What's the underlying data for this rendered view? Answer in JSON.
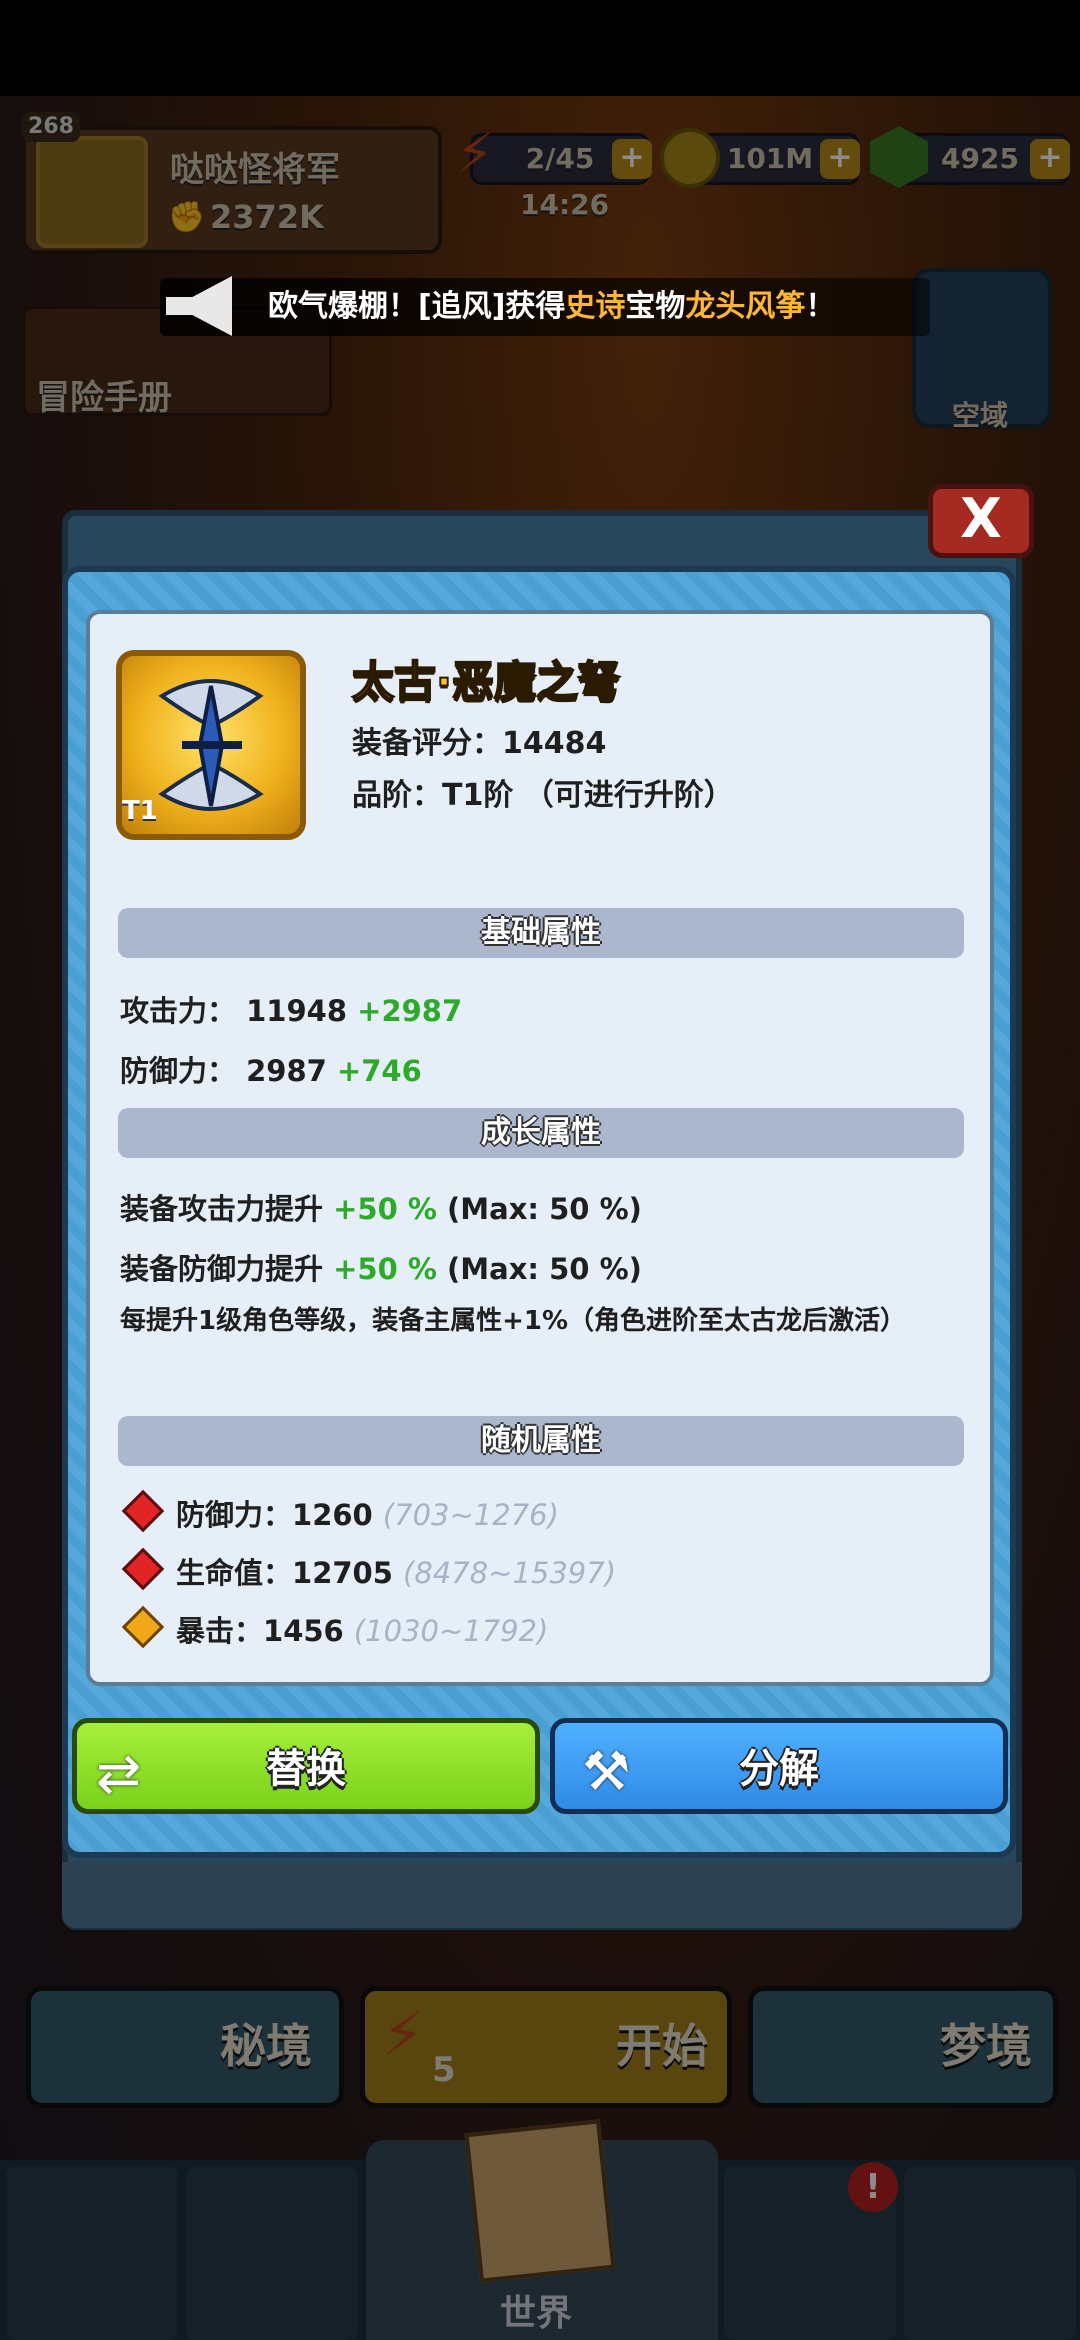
{
  "hud": {
    "level": "268",
    "player_name": "哒哒怪将军",
    "player_power": "2372K",
    "energy": "2/45",
    "energy_timer": "14:26",
    "coins": "101M",
    "gems": "4925",
    "plus": "+"
  },
  "announcement": {
    "prefix": "欧气爆棚！[追风]获得",
    "rarity": "史诗",
    "mid": "宝物",
    "item": "龙头风筝",
    "suffix": "！"
  },
  "side": {
    "adventure_book": "冒险手册",
    "airspace": "空域"
  },
  "item": {
    "name": "太古·恶魔之弩",
    "tier_badge": "T1",
    "score": "装备评分：14484",
    "grade": "品阶：T1阶 （可进行升阶）"
  },
  "sections": {
    "base": "基础属性",
    "growth": "成长属性",
    "random": "随机属性"
  },
  "base_stats": [
    {
      "label": "攻击力：",
      "value": "11948",
      "bonus": "+2987"
    },
    {
      "label": "防御力：",
      "value": "2987",
      "bonus": "+746"
    }
  ],
  "growth_stats": [
    {
      "label": "装备攻击力提升",
      "bonus": "+50 %",
      "max": "(Max: 50 %)"
    },
    {
      "label": "装备防御力提升",
      "bonus": "+50 %",
      "max": "(Max: 50 %)"
    }
  ],
  "growth_note": "每提升1级角色等级，装备主属性+1%（角色进阶至太古龙后激活）",
  "random_stats": [
    {
      "label": "防御力：",
      "value": "1260",
      "range": "(703~1276)",
      "gem": "red"
    },
    {
      "label": "生命值：",
      "value": "12705",
      "range": "(8478~15397)",
      "gem": "red"
    },
    {
      "label": "暴击：",
      "value": "1456",
      "range": "(1030~1792)",
      "gem": "gold"
    }
  ],
  "buttons": {
    "replace": "替换",
    "decompose": "分解",
    "close": "X"
  },
  "modes": {
    "secret": "秘境",
    "start": "开始",
    "start_count": "5",
    "dream": "梦境"
  },
  "nav": {
    "world": "世界",
    "alert": "!"
  }
}
